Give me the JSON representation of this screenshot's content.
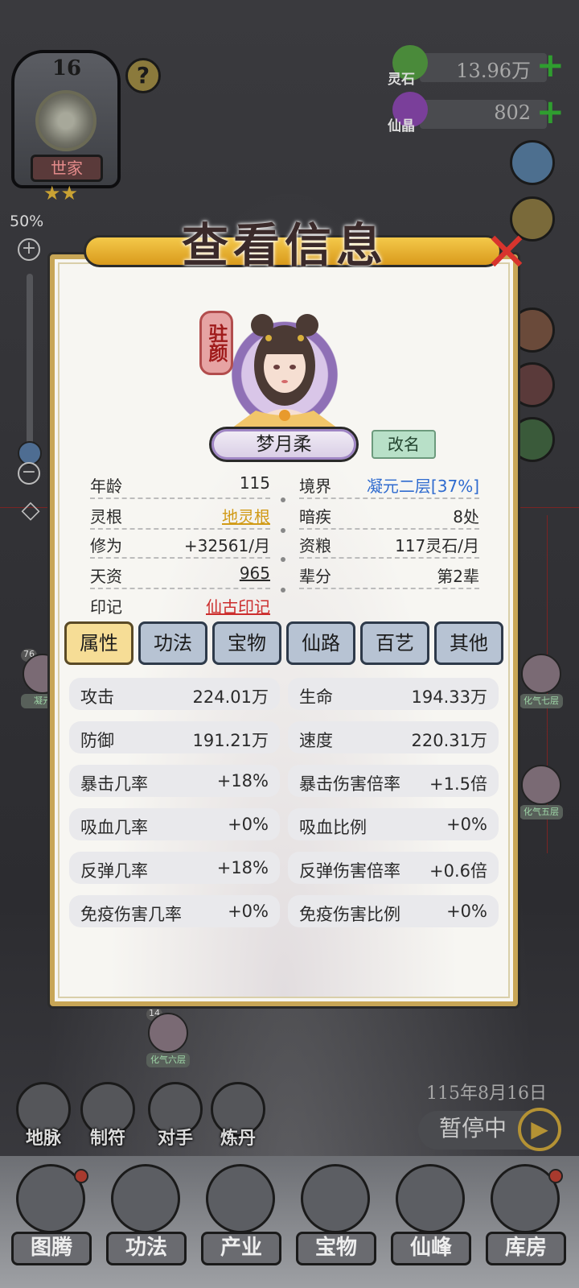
{
  "clan": {
    "level": "16",
    "name": "世家",
    "stars": "★★"
  },
  "zoom": {
    "percent": "50%",
    "plus": "+",
    "minus": "−",
    "level": 0.5
  },
  "currencies": [
    {
      "name": "灵石",
      "value": "13.96万",
      "icon": "spirit-stone-icon",
      "color": "#4a8a3a"
    },
    {
      "name": "仙晶",
      "value": "802",
      "icon": "immortal-crystal-icon",
      "color": "#7a3f9a"
    }
  ],
  "dialog": {
    "title": "查看信息",
    "close_glyph": "✕",
    "badge": "驻颜",
    "name": "梦月柔",
    "rename_label": "改名",
    "info": {
      "left": [
        {
          "key": "年龄",
          "value": "115"
        },
        {
          "key": "灵根",
          "value": "地灵根"
        },
        {
          "key": "修为",
          "value": "+32561/月"
        },
        {
          "key": "天资",
          "value": "965"
        },
        {
          "key": "印记",
          "value": "仙古印记"
        }
      ],
      "right": [
        {
          "key": "境界",
          "value": "凝元二层[37%]"
        },
        {
          "key": "暗疾",
          "value": "8处"
        },
        {
          "key": "资粮",
          "value": "117灵石/月"
        },
        {
          "key": "辈分",
          "value": "第2辈"
        }
      ]
    },
    "tabs": [
      "属性",
      "功法",
      "宝物",
      "仙路",
      "百艺",
      "其他"
    ],
    "active_tab": "属性",
    "stats": [
      {
        "key": "攻击",
        "value": "224.01万"
      },
      {
        "key": "生命",
        "value": "194.33万"
      },
      {
        "key": "防御",
        "value": "191.21万"
      },
      {
        "key": "速度",
        "value": "220.31万"
      },
      {
        "key": "暴击几率",
        "value": "+18%"
      },
      {
        "key": "暴击伤害倍率",
        "value": "+1.5倍"
      },
      {
        "key": "吸血几率",
        "value": "+0%"
      },
      {
        "key": "吸血比例",
        "value": "+0%"
      },
      {
        "key": "反弹几率",
        "value": "+18%"
      },
      {
        "key": "反弹伤害倍率",
        "value": "+0.6倍"
      },
      {
        "key": "免疫伤害几率",
        "value": "+0%"
      },
      {
        "key": "免疫伤害比例",
        "value": "+0%"
      }
    ]
  },
  "game_date": "115年8月16日",
  "pause_label": "暂停中",
  "tools": [
    "地脉",
    "制符",
    "对手",
    "炼丹"
  ],
  "nav": [
    "图腾",
    "功法",
    "产业",
    "宝物",
    "仙峰",
    "库房"
  ]
}
